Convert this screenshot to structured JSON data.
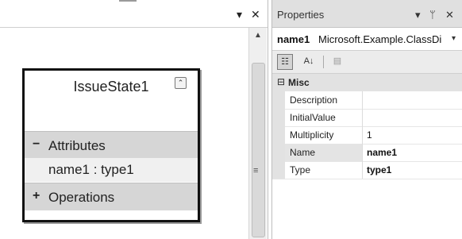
{
  "designer": {
    "dropdown_icon": "▾",
    "close_icon": "✕",
    "scroll_up_icon": "▲",
    "scroll_grip_icon": "≡",
    "shape": {
      "title": "IssueState1",
      "collapse_icon": "⌃",
      "attributes_toggle": "−",
      "attributes_label": "Attributes",
      "member": "name1 : type1",
      "operations_toggle": "+",
      "operations_label": "Operations"
    }
  },
  "properties": {
    "title": "Properties",
    "dropdown_icon": "▾",
    "pin_icon": "ᛘ",
    "close_icon": "✕",
    "selector": {
      "name": "name1",
      "type": "Microsoft.Example.ClassDi",
      "arrow": "▾"
    },
    "toolbar": {
      "categorized_icon": "☷",
      "alphabetical_icon": "A↓",
      "pages_icon": "▤"
    },
    "category": {
      "toggle": "⊟",
      "name": "Misc"
    },
    "rows": [
      {
        "name": "Description",
        "value": ""
      },
      {
        "name": "InitialValue",
        "value": ""
      },
      {
        "name": "Multiplicity",
        "value": "1"
      },
      {
        "name": "Name",
        "value": "name1"
      },
      {
        "name": "Type",
        "value": "type1"
      }
    ]
  }
}
